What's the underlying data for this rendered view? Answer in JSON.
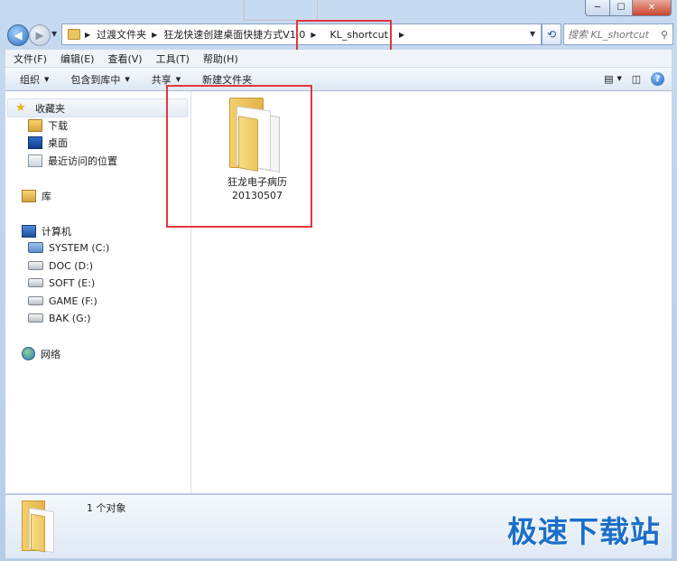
{
  "titlebar": {
    "minimize_glyph": "─",
    "maximize_glyph": "☐",
    "close_glyph": "✕"
  },
  "address": {
    "crumbs": [
      "过渡文件夹",
      "狂龙快速创建桌面快捷方式V1.0",
      "KL_shortcut"
    ],
    "search_placeholder": "搜索 KL_shortcut"
  },
  "menu": {
    "file": "文件(F)",
    "edit": "编辑(E)",
    "view": "查看(V)",
    "tools": "工具(T)",
    "help": "帮助(H)"
  },
  "commands": {
    "organize": "组织",
    "include_library": "包含到库中",
    "share": "共享",
    "new_folder": "新建文件夹"
  },
  "nav": {
    "favorites": "收藏夹",
    "favorites_items": [
      "下载",
      "桌面",
      "最近访问的位置"
    ],
    "libraries": "库",
    "computer": "计算机",
    "drives": [
      "SYSTEM (C:)",
      "DOC (D:)",
      "SOFT (E:)",
      "GAME (F:)",
      "BAK (G:)"
    ],
    "network": "网络"
  },
  "content": {
    "items": [
      {
        "name_line1": "狂龙电子病历",
        "name_line2": "20130507",
        "icon": "folder-icon"
      }
    ]
  },
  "details": {
    "object_count": "1 个对象"
  },
  "watermark": "极速下载站",
  "colors": {
    "highlight": "#e4353a",
    "folder": "#f0c75e",
    "watermark": "#1b6fc9"
  }
}
